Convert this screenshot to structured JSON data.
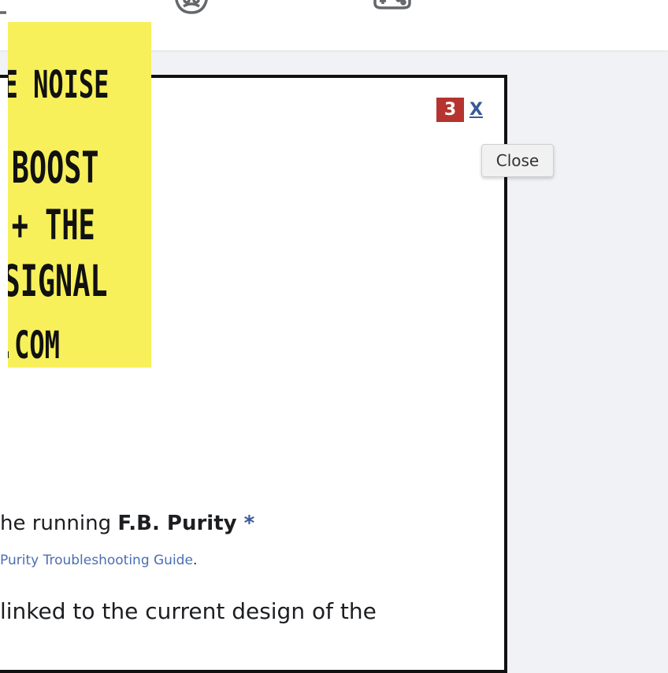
{
  "topbar": {
    "icons": [
      "groups-icon",
      "profile-icon",
      "gaming-icon"
    ]
  },
  "poster": {
    "alt_text_lines": [
      "E NOISE",
      "BOOST",
      "+ THE",
      "SIGNAL",
      ".COM"
    ]
  },
  "badge": {
    "label": "3"
  },
  "close_link": {
    "label": "X"
  },
  "tooltip": {
    "text": "Close"
  },
  "message": {
    "prefix": "he running ",
    "bold": "F.B. Purity",
    "asterisk": " *"
  },
  "troubleshooting": {
    "link_text": "Purity Troubleshooting Guide",
    "suffix": "."
  },
  "body_text": {
    "line1": "linked to the current design of the"
  },
  "colors": {
    "accent_link": "#385898",
    "badge_red": "#b5342f",
    "poster_yellow": "#f7f05a"
  }
}
